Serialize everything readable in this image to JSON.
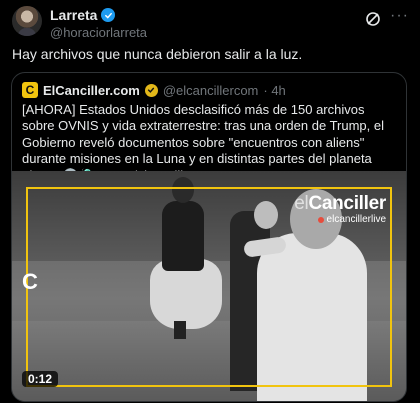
{
  "author": {
    "display_name": "Larreta",
    "handle": "@horaciorlarreta",
    "avatar_icon": "profile-photo-icon",
    "verified_icon": "verified-badge-icon"
  },
  "tweet": {
    "text": "Hay archivos que nunca debieron salir a la luz."
  },
  "quote": {
    "avatar_letter": "C",
    "display_name": "ElCanciller.com",
    "handle": "@elcancillercom",
    "time": "· 4h",
    "text": "[AHORA] Estados Unidos desclasificó más de 150 archivos sobre OVNIS y vida extraterrestre: tras una orden de Trump, el Gobierno reveló documentos sobre \"encuentros con aliens\" durante misiones en la Luna y en distintas partes del planeta Tierra. 👽🛸 x.com/elcancillercom…"
  },
  "video": {
    "watermark_prefix": "el",
    "watermark_brand": "Canciller",
    "watermark_sub": "elcancillerlive",
    "corner_logo": "C",
    "duration": "0:12",
    "frame_color": "#f1c40f"
  },
  "colors": {
    "background": "#000000",
    "text": "#e7e9ea",
    "muted": "#71767b",
    "verified_blue": "#1d9bf0",
    "gold_badge": "#e2b719"
  }
}
